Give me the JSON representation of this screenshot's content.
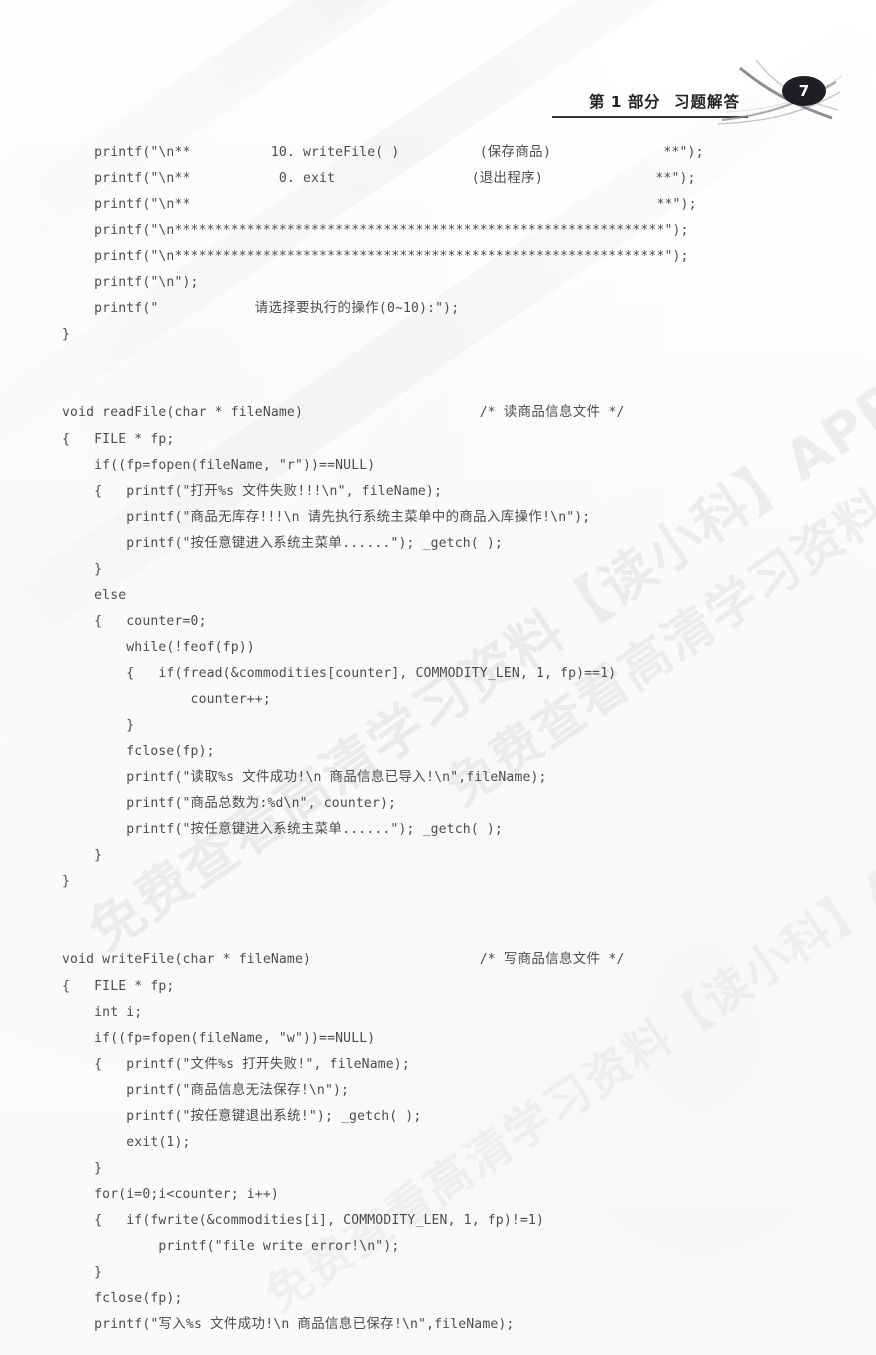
{
  "header": {
    "part_label": "第 1 部分",
    "section_title": "习题解答",
    "page_number": "7"
  },
  "watermark": {
    "text": "免费查看高清学习资料【读小科】APP"
  },
  "code": {
    "language": "c",
    "lines": [
      {
        "id": "l1",
        "indent": 4,
        "text": "printf(\"\\n**          10. writeFile( )          (保存商品)              **\");"
      },
      {
        "id": "l2",
        "indent": 4,
        "text": "printf(\"\\n**           0. exit                 (退出程序)              **\");"
      },
      {
        "id": "l3",
        "indent": 4,
        "text": "printf(\"\\n**                                                          **\");"
      },
      {
        "id": "l4",
        "indent": 4,
        "text": "printf(\"\\n*************************************************************\");"
      },
      {
        "id": "l5",
        "indent": 4,
        "text": "printf(\"\\n*************************************************************\");"
      },
      {
        "id": "l6",
        "indent": 4,
        "text": "printf(\"\\n\");"
      },
      {
        "id": "l7",
        "indent": 4,
        "text": "printf(\"            请选择要执行的操作(0~10):\");"
      },
      {
        "id": "l8",
        "indent": 0,
        "text": "}"
      },
      {
        "id": "l9",
        "indent": 0,
        "text": ""
      },
      {
        "id": "l10",
        "indent": 0,
        "text": ""
      },
      {
        "id": "l11",
        "indent": 0,
        "text": "void readFile(char * fileName)",
        "comment": "/* 读商品信息文件 */",
        "comment_col": 52
      },
      {
        "id": "l12",
        "indent": 0,
        "text": "{   FILE * fp;"
      },
      {
        "id": "l13",
        "indent": 4,
        "text": "if((fp=fopen(fileName, \"r\"))==NULL)"
      },
      {
        "id": "l14",
        "indent": 4,
        "text": "{   printf(\"打开%s 文件失败!!!\\n\", fileName);"
      },
      {
        "id": "l15",
        "indent": 8,
        "text": "printf(\"商品无库存!!!\\n 请先执行系统主菜单中的商品入库操作!\\n\");"
      },
      {
        "id": "l16",
        "indent": 8,
        "text": "printf(\"按任意键进入系统主菜单......\"); _getch( );"
      },
      {
        "id": "l17",
        "indent": 4,
        "text": "}"
      },
      {
        "id": "l18",
        "indent": 4,
        "text": "else"
      },
      {
        "id": "l19",
        "indent": 4,
        "text": "{   counter=0;"
      },
      {
        "id": "l20",
        "indent": 8,
        "text": "while(!feof(fp))"
      },
      {
        "id": "l21",
        "indent": 8,
        "text": "{   if(fread(&commodities[counter], COMMODITY_LEN, 1, fp)==1)"
      },
      {
        "id": "l22",
        "indent": 16,
        "text": "counter++;"
      },
      {
        "id": "l23",
        "indent": 8,
        "text": "}"
      },
      {
        "id": "l24",
        "indent": 8,
        "text": "fclose(fp);"
      },
      {
        "id": "l25",
        "indent": 8,
        "text": "printf(\"读取%s 文件成功!\\n 商品信息已导入!\\n\",fileName);"
      },
      {
        "id": "l26",
        "indent": 8,
        "text": "printf(\"商品总数为:%d\\n\", counter);"
      },
      {
        "id": "l27",
        "indent": 8,
        "text": "printf(\"按任意键进入系统主菜单......\"); _getch( );"
      },
      {
        "id": "l28",
        "indent": 4,
        "text": "}"
      },
      {
        "id": "l29",
        "indent": 0,
        "text": "}"
      },
      {
        "id": "l30",
        "indent": 0,
        "text": ""
      },
      {
        "id": "l31",
        "indent": 0,
        "text": ""
      },
      {
        "id": "l32",
        "indent": 0,
        "text": "void writeFile(char * fileName)",
        "comment": "/* 写商品信息文件 */",
        "comment_col": 52
      },
      {
        "id": "l33",
        "indent": 0,
        "text": "{   FILE * fp;"
      },
      {
        "id": "l34",
        "indent": 4,
        "text": "int i;"
      },
      {
        "id": "l35",
        "indent": 4,
        "text": "if((fp=fopen(fileName, \"w\"))==NULL)"
      },
      {
        "id": "l36",
        "indent": 4,
        "text": "{   printf(\"文件%s 打开失败!\", fileName);"
      },
      {
        "id": "l37",
        "indent": 8,
        "text": "printf(\"商品信息无法保存!\\n\");"
      },
      {
        "id": "l38",
        "indent": 8,
        "text": "printf(\"按任意键退出系统!\"); _getch( );"
      },
      {
        "id": "l39",
        "indent": 8,
        "text": "exit(1);"
      },
      {
        "id": "l40",
        "indent": 4,
        "text": "}"
      },
      {
        "id": "l41",
        "indent": 4,
        "text": "for(i=0;i<counter; i++)"
      },
      {
        "id": "l42",
        "indent": 4,
        "text": "{   if(fwrite(&commodities[i], COMMODITY_LEN, 1, fp)!=1)"
      },
      {
        "id": "l43",
        "indent": 12,
        "text": "printf(\"file write error!\\n\");"
      },
      {
        "id": "l44",
        "indent": 4,
        "text": "}"
      },
      {
        "id": "l45",
        "indent": 4,
        "text": "fclose(fp);"
      },
      {
        "id": "l46",
        "indent": 4,
        "text": "printf(\"写入%s 文件成功!\\n 商品信息已保存!\\n\",fileName);"
      }
    ]
  }
}
